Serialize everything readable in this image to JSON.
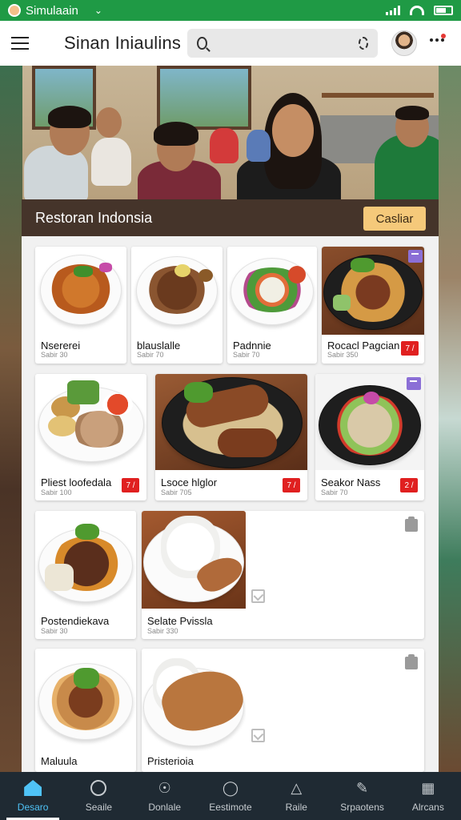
{
  "status_bar": {
    "app_label": "Simulaain"
  },
  "app_bar": {
    "title": "Sinan Iniaulins",
    "search_placeholder": ""
  },
  "restaurant": {
    "title": "Restoran Indonsia",
    "action_label": "Casliar"
  },
  "menu_items": [
    {
      "name": "Nsererei",
      "price": "Sabir 30",
      "badge": ""
    },
    {
      "name": "blauslalle",
      "price": "Sabir 70",
      "badge": ""
    },
    {
      "name": "Padnnie",
      "price": "Sabir 70",
      "badge": ""
    },
    {
      "name": "Rocacl Pagcian",
      "price": "Sabir 350",
      "badge": "7 /"
    },
    {
      "name": "Pliest loofedala",
      "price": "Sabir 100",
      "badge": "7 /"
    },
    {
      "name": "Lsoce hlglor",
      "price": "Sabir 705",
      "badge": "7 /"
    },
    {
      "name": "Seakor Nass",
      "price": "Sabir 70",
      "badge": "2 /"
    },
    {
      "name": "Postendiekava",
      "price": "Sabir 30",
      "badge": ""
    },
    {
      "name": "Selate Pvissla",
      "price": "Sabir 330",
      "badge": ""
    },
    {
      "name": "Maluula",
      "price": "",
      "badge": ""
    },
    {
      "name": "Pristerioia",
      "price": "",
      "badge": ""
    }
  ],
  "bottom_nav": [
    {
      "label": "Desaro",
      "icon": "home-icon",
      "active": true
    },
    {
      "label": "Seaile",
      "icon": "search-icon"
    },
    {
      "label": "Donlale",
      "icon": "compass-icon"
    },
    {
      "label": "Eestimote",
      "icon": "location-icon"
    },
    {
      "label": "Raile",
      "icon": "upload-icon"
    },
    {
      "label": "Srpaotens",
      "icon": "edit-icon"
    },
    {
      "label": "Alrcans",
      "icon": "grid-icon"
    }
  ],
  "colors": {
    "status_bar": "#1f9a45",
    "header_brown": "#45342a",
    "action_button": "#f5c97a",
    "badge_red": "#e02020",
    "nav_bg": "#1f2a33",
    "nav_active": "#4fc3f7"
  }
}
